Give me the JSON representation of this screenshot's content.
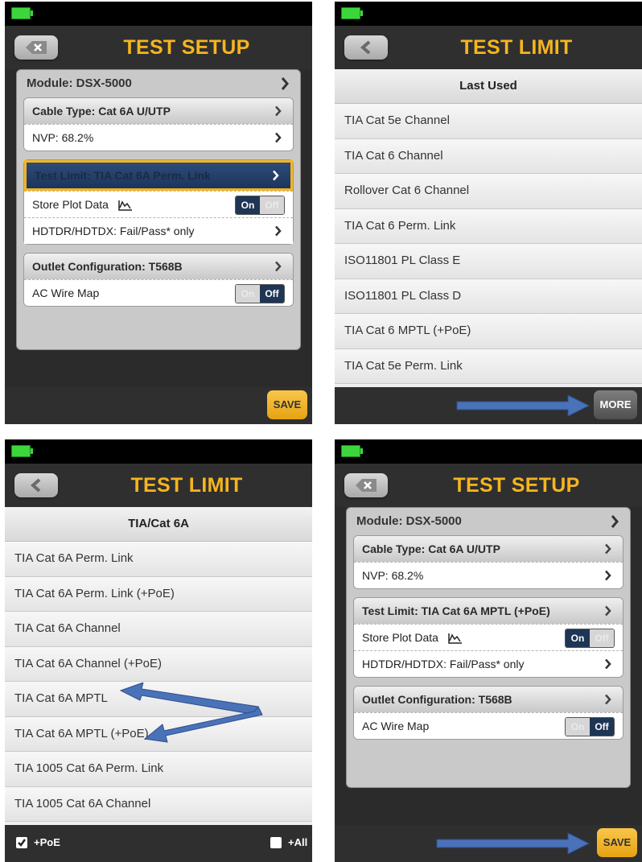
{
  "panel1": {
    "title": "TEST SETUP",
    "module": "Module: DSX-5000",
    "cable_type": "Cable Type: Cat 6A U/UTP",
    "nvp": "NVP: 68.2%",
    "test_limit": "Test Limit: TIA Cat 6A Perm. Link",
    "store_plot": "Store Plot Data",
    "store_plot_toggle": {
      "on": "On",
      "off": "Off",
      "state": "on"
    },
    "hdtdr": "HDTDR/HDTDX: Fail/Pass* only",
    "outlet": "Outlet Configuration: T568B",
    "ac_wire_map": "AC Wire Map",
    "ac_toggle": {
      "on": "On",
      "off": "Off",
      "state": "off"
    },
    "save": "SAVE"
  },
  "panel2": {
    "title": "TEST LIMIT",
    "header": "Last Used",
    "items": [
      "TIA Cat 5e Channel",
      "TIA Cat 6 Channel",
      "Rollover Cat 6 Channel",
      "TIA Cat 6 Perm. Link",
      "ISO11801 PL Class E",
      "ISO11801 PL Class D",
      "TIA Cat 6 MPTL (+PoE)",
      "TIA Cat 5e Perm. Link"
    ],
    "more": "MORE"
  },
  "panel3": {
    "title": "TEST LIMIT",
    "header": "TIA/Cat 6A",
    "items": [
      "TIA Cat 6A Perm. Link",
      "TIA Cat 6A Perm. Link (+PoE)",
      "TIA Cat 6A Channel",
      "TIA Cat 6A Channel (+PoE)",
      "TIA Cat 6A MPTL",
      "TIA Cat 6A MPTL (+PoE)",
      "TIA 1005 Cat 6A Perm. Link",
      "TIA 1005 Cat 6A Channel"
    ],
    "poe_label": "+PoE",
    "poe_checked": true,
    "all_label": "+All",
    "all_checked": false
  },
  "panel4": {
    "title": "TEST SETUP",
    "module": "Module: DSX-5000",
    "cable_type": "Cable Type: Cat 6A U/UTP",
    "nvp": "NVP: 68.2%",
    "test_limit": "Test Limit: TIA Cat 6A MPTL (+PoE)",
    "store_plot": "Store Plot Data",
    "store_plot_toggle": {
      "on": "On",
      "off": "Off",
      "state": "on"
    },
    "hdtdr": "HDTDR/HDTDX: Fail/Pass* only",
    "outlet": "Outlet Configuration: T568B",
    "ac_wire_map": "AC Wire Map",
    "ac_toggle": {
      "on": "On",
      "off": "Off",
      "state": "off"
    },
    "save": "SAVE"
  },
  "colors": {
    "title": "#f5b51e",
    "save": "#f5b51e",
    "selected_row": "#1f3555",
    "highlight_border": "#f5b51e",
    "annotation_arrow": "#4a72b8",
    "battery": "#3cd63c"
  },
  "icons": {
    "back": "close-x-back-icon",
    "chevron": "chevron-right-icon",
    "plot": "plot-data-icon",
    "checkbox": "checkbox-icon"
  }
}
